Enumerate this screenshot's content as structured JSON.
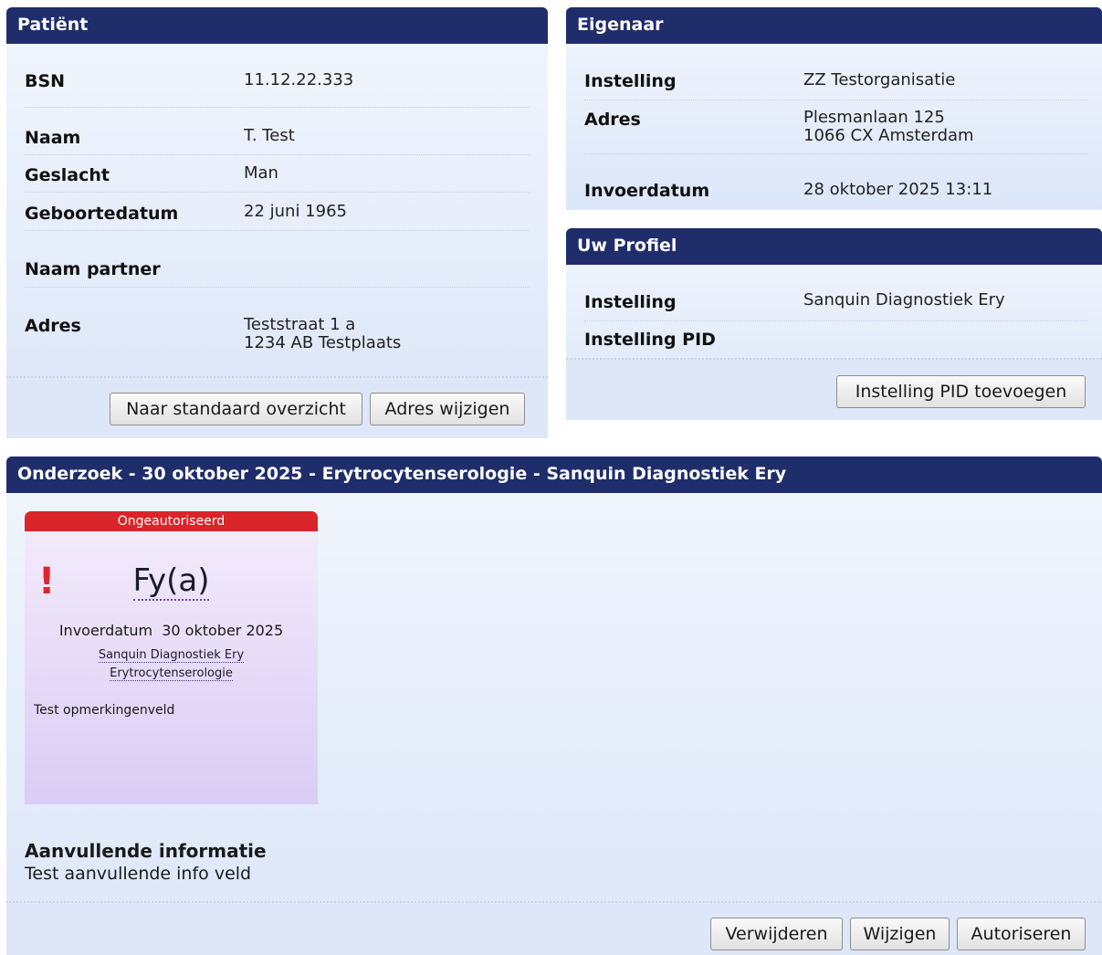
{
  "patient": {
    "title": "Patiënt",
    "fields": [
      {
        "label": "BSN",
        "value": "11.12.22.333"
      },
      {
        "label": "Naam",
        "value": "T. Test"
      },
      {
        "label": "Geslacht",
        "value": "Man"
      },
      {
        "label": "Geboortedatum",
        "value": "22 juni 1965"
      },
      {
        "label": "Naam partner",
        "value": ""
      },
      {
        "label": "Adres",
        "value": "Teststraat 1 a\n1234 AB Testplaats"
      }
    ],
    "buttons": {
      "overview": "Naar standaard overzicht",
      "change_address": "Adres wijzigen"
    }
  },
  "owner": {
    "title": "Eigenaar",
    "fields": [
      {
        "label": "Instelling",
        "value": "ZZ Testorganisatie"
      },
      {
        "label": "Adres",
        "value": "Plesmanlaan 125\n1066 CX  Amsterdam"
      },
      {
        "label": "Invoerdatum",
        "value": "28 oktober 2025 13:11"
      }
    ]
  },
  "profile": {
    "title": "Uw Profiel",
    "fields": [
      {
        "label": "Instelling",
        "value": "Sanquin Diagnostiek Ery"
      },
      {
        "label": "Instelling PID",
        "value": ""
      }
    ],
    "buttons": {
      "add_pid": "Instelling PID toevoegen"
    }
  },
  "exam": {
    "title": "Onderzoek - 30 oktober 2025 - Erytrocytenserologie - Sanquin Diagnostiek Ery",
    "card": {
      "status": "Ongeautoriseerd",
      "alert": "!",
      "test": "Fy(a)",
      "date_label": "Invoerdatum",
      "date_value": "30 oktober 2025",
      "lab": "Sanquin Diagnostiek Ery",
      "department": "Erytrocytenserologie",
      "note": "Test opmerkingenveld"
    },
    "additional_heading": "Aanvullende informatie",
    "additional_text": "Test aanvullende info veld",
    "buttons": {
      "delete": "Verwijderen",
      "edit": "Wijzigen",
      "authorize": "Autoriseren"
    }
  },
  "colors": {
    "header_bg": "#1f2d6b",
    "status_red": "#d9252a",
    "panel_bg": "#e4ecfa",
    "card_bg": "#e4daf7"
  }
}
